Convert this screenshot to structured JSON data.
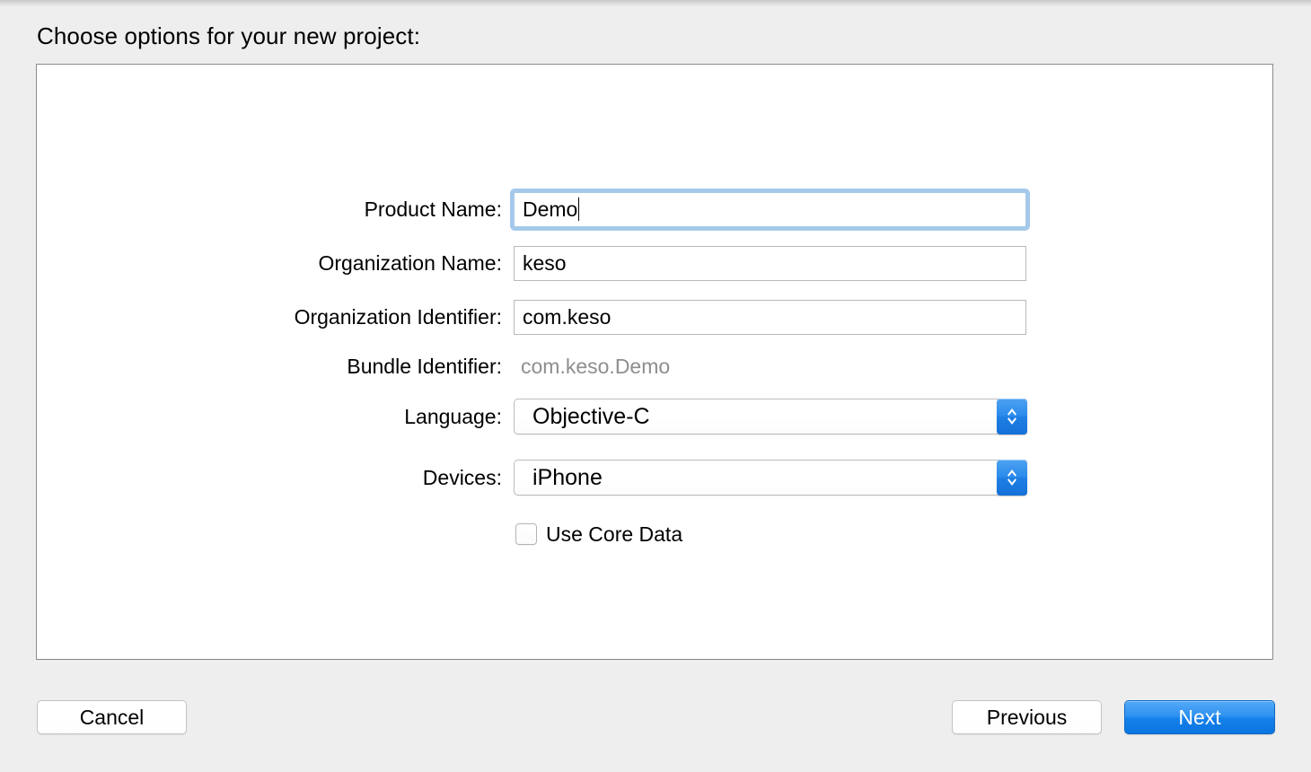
{
  "window": {
    "heading": "Choose options for your new project:"
  },
  "form": {
    "rows": [
      {
        "label": "Product Name:",
        "value": "Demo",
        "type": "text-field",
        "focused": true
      },
      {
        "label": "Organization Name:",
        "value": "keso",
        "type": "text-field",
        "focused": false
      },
      {
        "label": "Organization Identifier:",
        "value": "com.keso",
        "type": "text-field",
        "focused": false
      },
      {
        "label": "Bundle Identifier:",
        "value": "com.keso.Demo",
        "type": "static-text",
        "focused": false
      },
      {
        "label": "Language:",
        "value": "Objective-C",
        "type": "popup-button",
        "focused": false
      },
      {
        "label": "Devices:",
        "value": "iPhone",
        "type": "popup-button",
        "focused": false
      }
    ],
    "checkbox": {
      "label": "Use Core Data",
      "checked": false
    }
  },
  "footer": {
    "cancel_label": "Cancel",
    "previous_label": "Previous",
    "next_label": "Next"
  },
  "colors": {
    "background": "#eeeeee",
    "panel": "#ffffff",
    "panel_border": "#8c8c8c",
    "focus_ring": "#a4c9ea",
    "accent_blue": "#1580ea",
    "disabled_text": "#8e8e8e"
  }
}
